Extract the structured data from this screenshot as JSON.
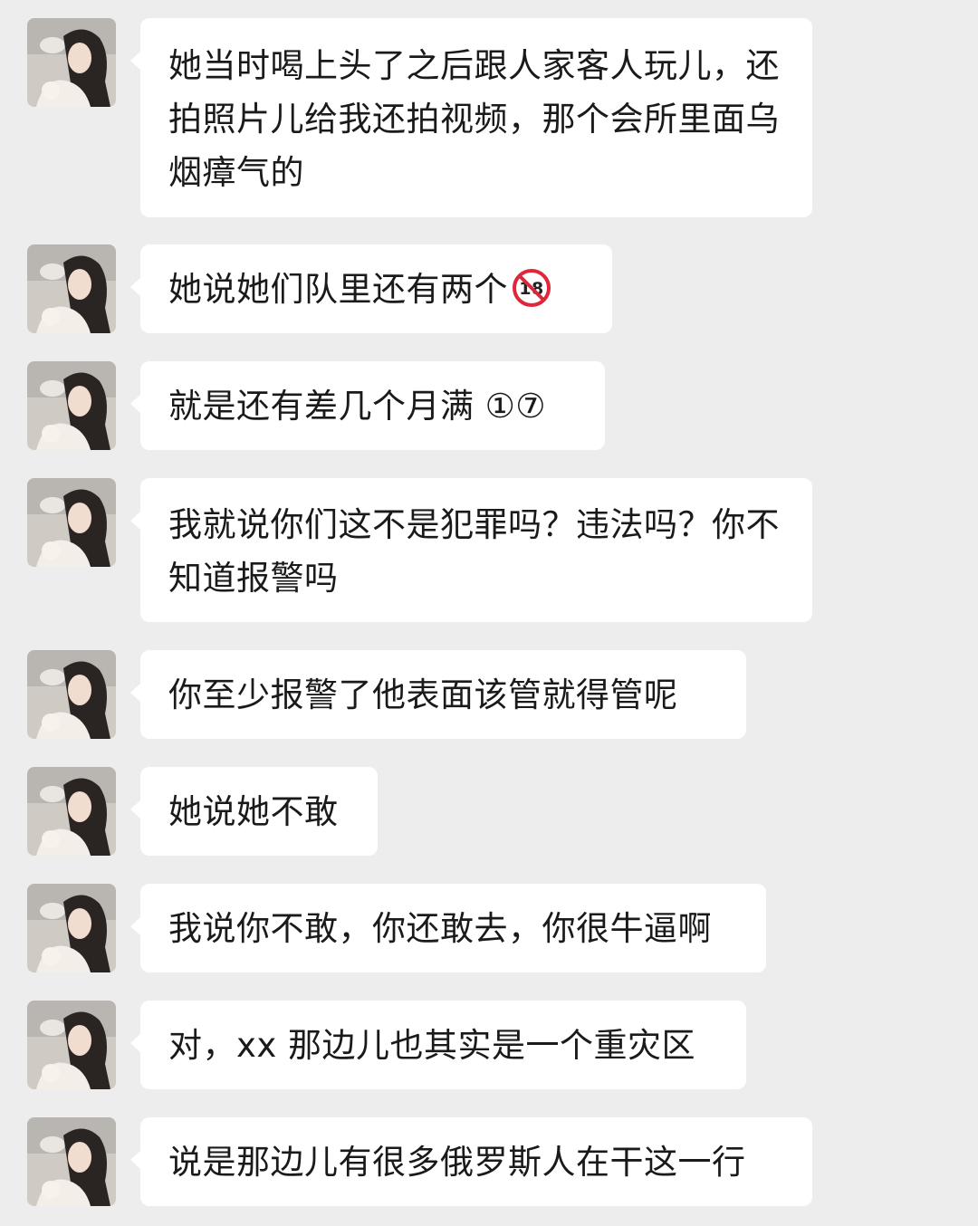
{
  "messages": [
    {
      "text": "她当时喝上头了之后跟人家客人玩儿，还拍照片儿给我还拍视频，那个会所里面乌烟瘴气的"
    },
    {
      "text": "她说她们队里还有两个",
      "emoji": "no-one-under-18-icon"
    },
    {
      "text": "就是还有差几个月满 ①⑦"
    },
    {
      "text": "我就说你们这不是犯罪吗？违法吗？你不知道报警吗"
    },
    {
      "text": "你至少报警了他表面该管就得管呢"
    },
    {
      "text": "她说她不敢"
    },
    {
      "text": "我说你不敢，你还敢去，你很牛逼啊"
    },
    {
      "text": "对，xx 那边儿也其实是一个重灾区"
    },
    {
      "text": "说是那边儿有很多俄罗斯人在干这一行"
    }
  ],
  "colors": {
    "background": "#ededed",
    "bubble": "#ffffff",
    "text": "#1a1a1a",
    "emoji_red": "#e0263b"
  }
}
